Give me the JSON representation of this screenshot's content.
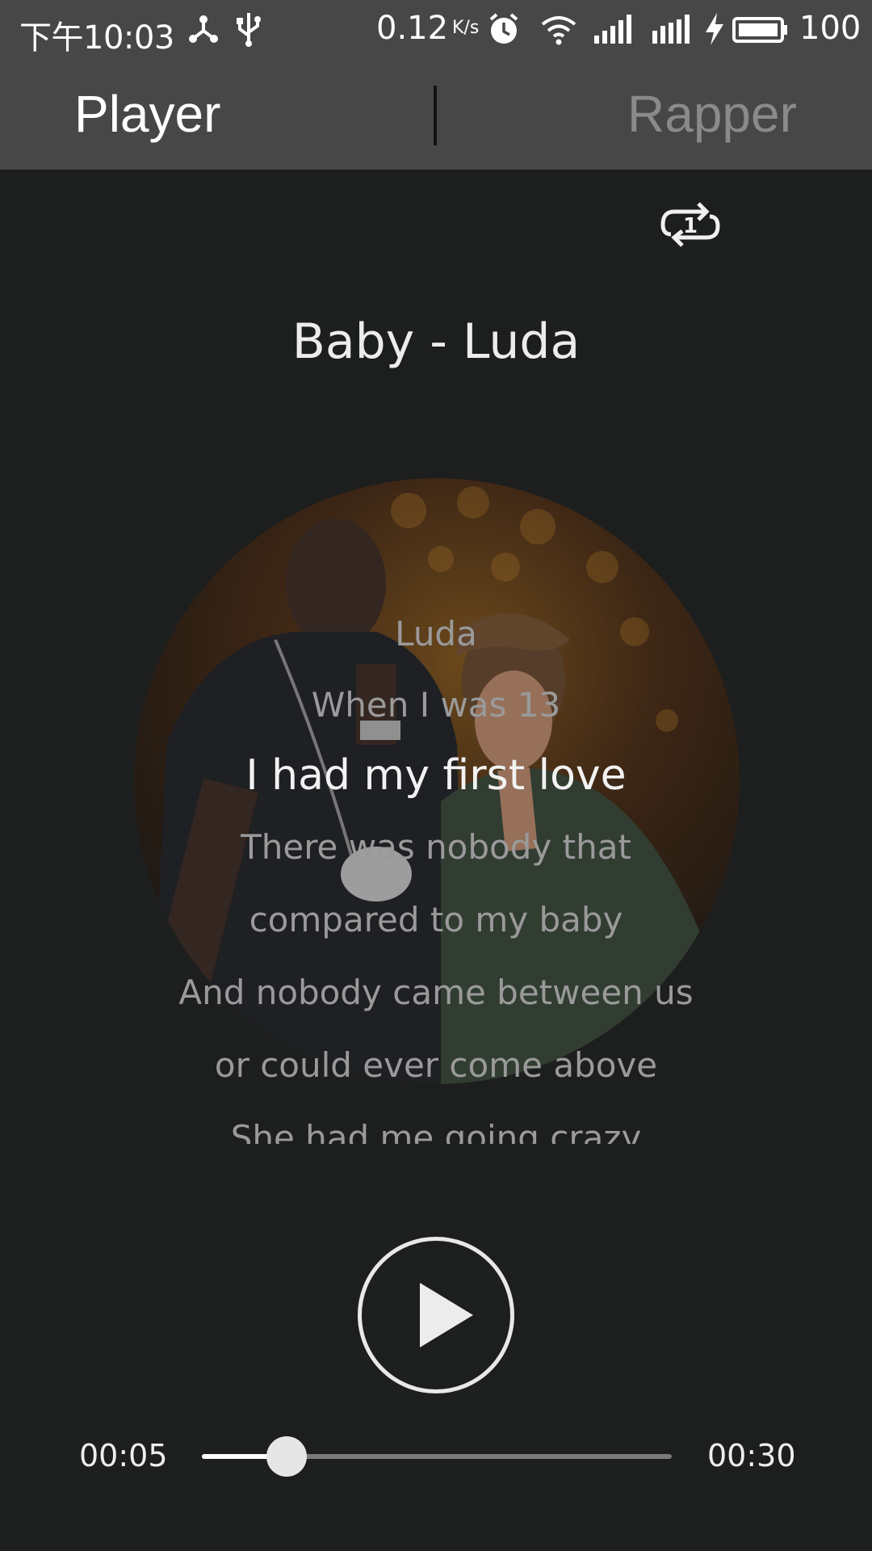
{
  "status_bar": {
    "time": "下午10:03",
    "net_speed": "0.12",
    "net_speed_unit": "K/s",
    "network_type": "4G",
    "battery_level": "100",
    "icons": [
      "share-icon",
      "usb-icon",
      "alarm-icon",
      "wifi-icon",
      "signal-icon",
      "signal-4g-icon",
      "charging-icon",
      "battery-icon"
    ]
  },
  "tabs": [
    {
      "label": "Player",
      "active": true
    },
    {
      "label": "Rapper",
      "active": false
    }
  ],
  "repeat": {
    "icon": "repeat-one-icon",
    "mode": "1"
  },
  "song": {
    "title": "Baby - Luda"
  },
  "lyrics": {
    "lines": [
      "Luda",
      "When I was 13",
      "I had my first love",
      "There was nobody that",
      "compared to my baby",
      "And nobody came between us",
      "or could ever come above",
      "She had me going crazy"
    ],
    "active_index": 2
  },
  "player": {
    "play_icon": "play-icon",
    "current_time": "00:05",
    "total_time": "00:30",
    "progress": 0.18
  },
  "colors": {
    "background": "#1d1e1e",
    "header": "#474747",
    "active_tab": "#ffffff",
    "inactive_tab": "#8a8a8a"
  }
}
